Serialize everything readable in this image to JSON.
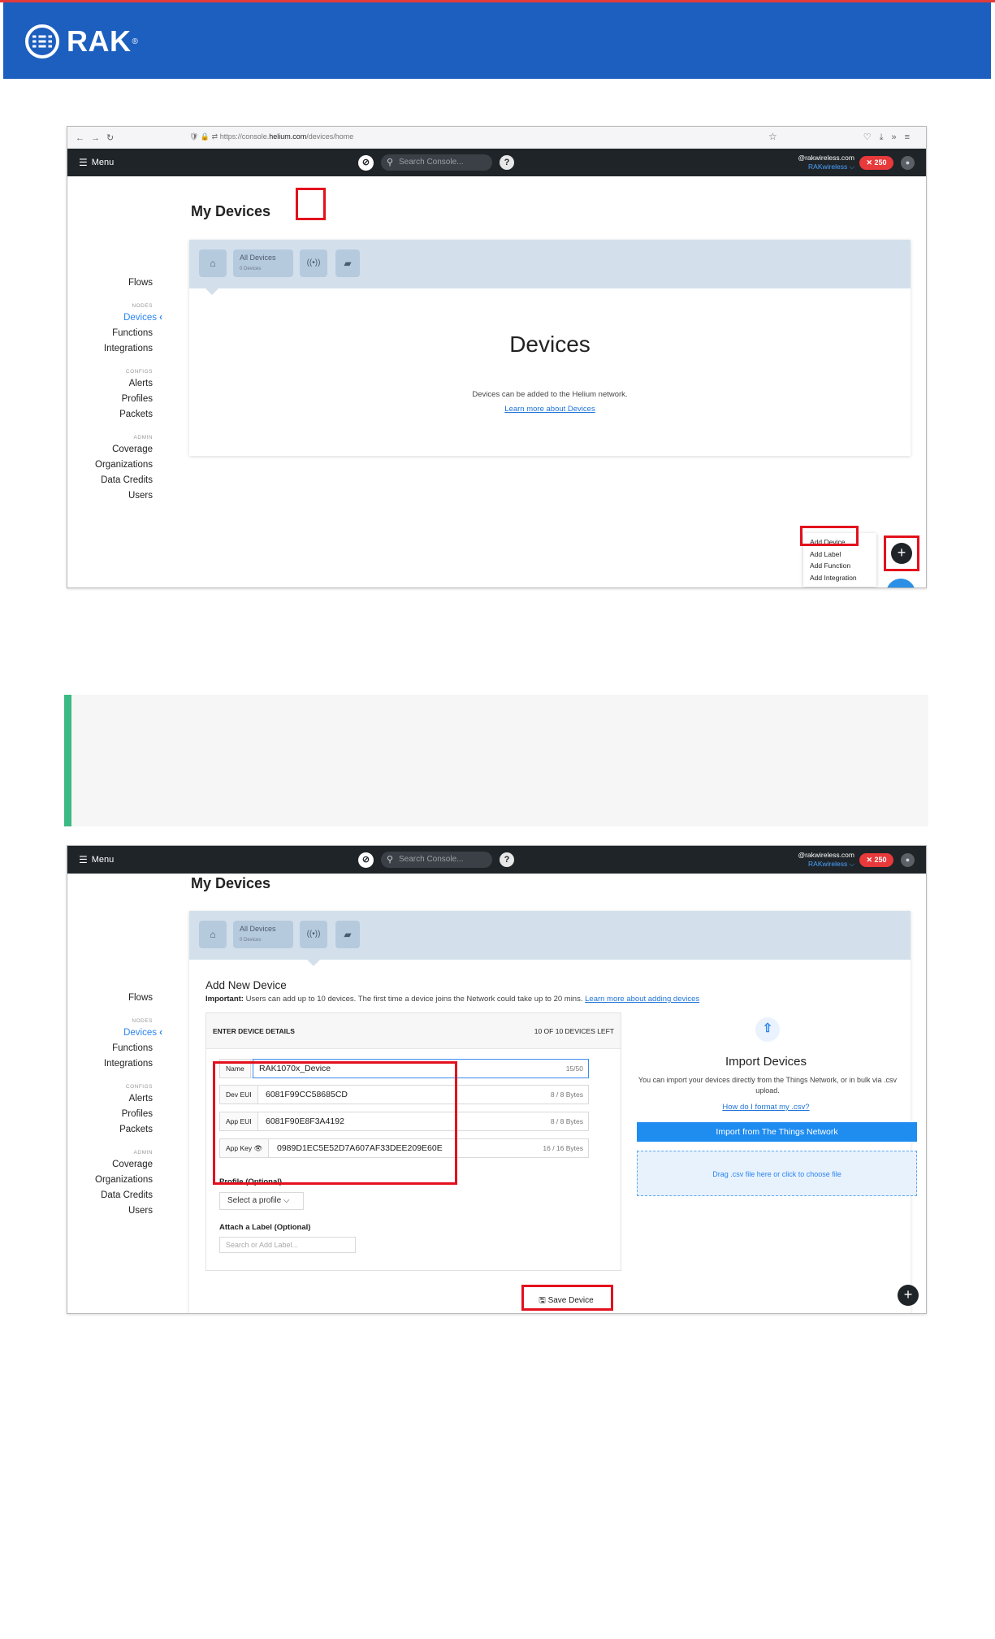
{
  "header": {
    "brand": "RAK",
    "brand_mark": "®",
    "logo_icon": "rak-logo-icon",
    "bg_color": "#1d5fbf"
  },
  "browser": {
    "url_prefix": "https://console.",
    "url_domain": "helium.com",
    "url_path": "/devices/home"
  },
  "app_nav": {
    "menu_label": "Menu",
    "search_placeholder": "Search Console...",
    "help_label": "?",
    "account_email": "@rakwireless.com",
    "account_org": "RAKwireless ⌵",
    "data_credits": "250",
    "dc_color": "#e8393b"
  },
  "sidebar": {
    "flows": "Flows",
    "nodes_section": "NODES",
    "devices": "Devices",
    "functions": "Functions",
    "integrations": "Integrations",
    "configs_section": "CONFIGS",
    "alerts": "Alerts",
    "profiles": "Profiles",
    "packets": "Packets",
    "admin_section": "ADMIN",
    "coverage": "Coverage",
    "organizations": "Organizations",
    "data_credits": "Data Credits",
    "users": "Users"
  },
  "page_title": "My Devices",
  "toolbar": {
    "all_devices": "All Devices",
    "all_devices_count": "0 Devices"
  },
  "devices_panel": {
    "heading": "Devices",
    "description": "Devices can be added to the Helium network.",
    "link": "Learn more about Devices"
  },
  "add_menu": {
    "items": [
      "Add Device",
      "Add Label",
      "Add Function",
      "Add Integration"
    ]
  },
  "form": {
    "title": "Add New Device",
    "important_label": "Important:",
    "important_text": " Users can add up to 10 devices. The first time a device joins the Network could take up to 20 mins. ",
    "important_link": "Learn more about adding devices",
    "details_header": "ENTER DEVICE DETAILS",
    "devices_left": "10 OF 10 DEVICES LEFT",
    "fields": [
      {
        "label": "Name",
        "value": "RAK1070x_Device",
        "count": "15/50"
      },
      {
        "label": "Dev EUI",
        "value": "6081F99CC58685CD",
        "count": "8 / 8 Bytes"
      },
      {
        "label": "App EUI",
        "value": "6081F90E8F3A4192",
        "count": "8 / 8 Bytes"
      },
      {
        "label": "App Key 👁",
        "value": "0989D1EC5E52D7A607AF33DEE209E60E",
        "count": "16 / 16 Bytes"
      }
    ],
    "profile_label": "Profile (Optional)",
    "profile_select": "Select a profile ⌵",
    "label_label": "Attach a Label (Optional)",
    "label_placeholder": "Search or Add Label...",
    "save_button": "Save Device"
  },
  "import": {
    "heading": "Import Devices",
    "description": "You can import your devices directly from the Things Network, or in bulk via .csv upload.",
    "link": "How do I format my .csv?",
    "button": "Import from The Things Network",
    "drop_zone": "Drag .csv file here or click to choose file"
  },
  "highlight_color": "#e3101d",
  "note_accent": "#3cba84"
}
